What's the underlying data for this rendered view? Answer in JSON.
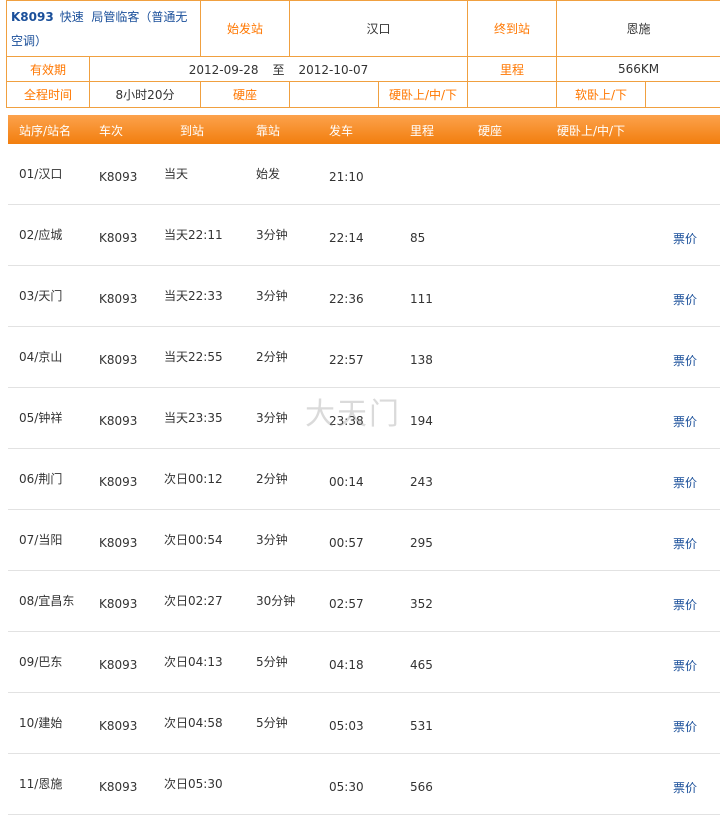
{
  "info": {
    "train_no": "K8093",
    "train_type": "快速",
    "train_desc": "局管临客（普通无空调）",
    "start_station_label": "始发站",
    "start_station": "汉口",
    "end_station_label": "终到站",
    "end_station": "恩施",
    "validity_label": "有效期",
    "valid_from": "2012-09-28",
    "valid_sep": "至",
    "valid_to": "2012-10-07",
    "distance_label": "里程",
    "distance": "566KM",
    "duration_label": "全程时间",
    "duration": "8小时20分",
    "hard_seat_label": "硬座",
    "hard_sleeper_label": "硬卧上/中/下",
    "soft_sleeper_label": "软卧上/下"
  },
  "schedule": {
    "headers": [
      "站序/站名",
      "车次",
      "到站",
      "靠站",
      "发车",
      "里程",
      "硬座",
      "硬卧上/中/下"
    ],
    "rows": [
      {
        "station": "01/汉口",
        "train": "K8093",
        "arrive": "当天",
        "stop": "始发",
        "depart": "21:10",
        "km": "",
        "price": ""
      },
      {
        "station": "02/应城",
        "train": "K8093",
        "arrive": "当天22:11",
        "stop": "3分钟",
        "depart": "22:14",
        "km": "85",
        "price": "票价"
      },
      {
        "station": "03/天门",
        "train": "K8093",
        "arrive": "当天22:33",
        "stop": "3分钟",
        "depart": "22:36",
        "km": "111",
        "price": "票价"
      },
      {
        "station": "04/京山",
        "train": "K8093",
        "arrive": "当天22:55",
        "stop": "2分钟",
        "depart": "22:57",
        "km": "138",
        "price": "票价"
      },
      {
        "station": "05/钟祥",
        "train": "K8093",
        "arrive": "当天23:35",
        "stop": "3分钟",
        "depart": "23:38",
        "km": "194",
        "price": "票价"
      },
      {
        "station": "06/荆门",
        "train": "K8093",
        "arrive": "次日00:12",
        "stop": "2分钟",
        "depart": "00:14",
        "km": "243",
        "price": "票价"
      },
      {
        "station": "07/当阳",
        "train": "K8093",
        "arrive": "次日00:54",
        "stop": "3分钟",
        "depart": "00:57",
        "km": "295",
        "price": "票价"
      },
      {
        "station": "08/宜昌东",
        "train": "K8093",
        "arrive": "次日02:27",
        "stop": "30分钟",
        "depart": "02:57",
        "km": "352",
        "price": "票价"
      },
      {
        "station": "09/巴东",
        "train": "K8093",
        "arrive": "次日04:13",
        "stop": "5分钟",
        "depart": "04:18",
        "km": "465",
        "price": "票价"
      },
      {
        "station": "10/建始",
        "train": "K8093",
        "arrive": "次日04:58",
        "stop": "5分钟",
        "depart": "05:03",
        "km": "531",
        "price": "票价"
      },
      {
        "station": "11/恩施",
        "train": "K8093",
        "arrive": "次日05:30",
        "stop": "",
        "depart": "05:30",
        "km": "566",
        "price": "票价"
      }
    ]
  },
  "watermark": "大天门",
  "colors": {
    "accent": "#f78a1f",
    "label": "#ff7700",
    "link": "#1a4f9a",
    "border": "#f0a040"
  }
}
